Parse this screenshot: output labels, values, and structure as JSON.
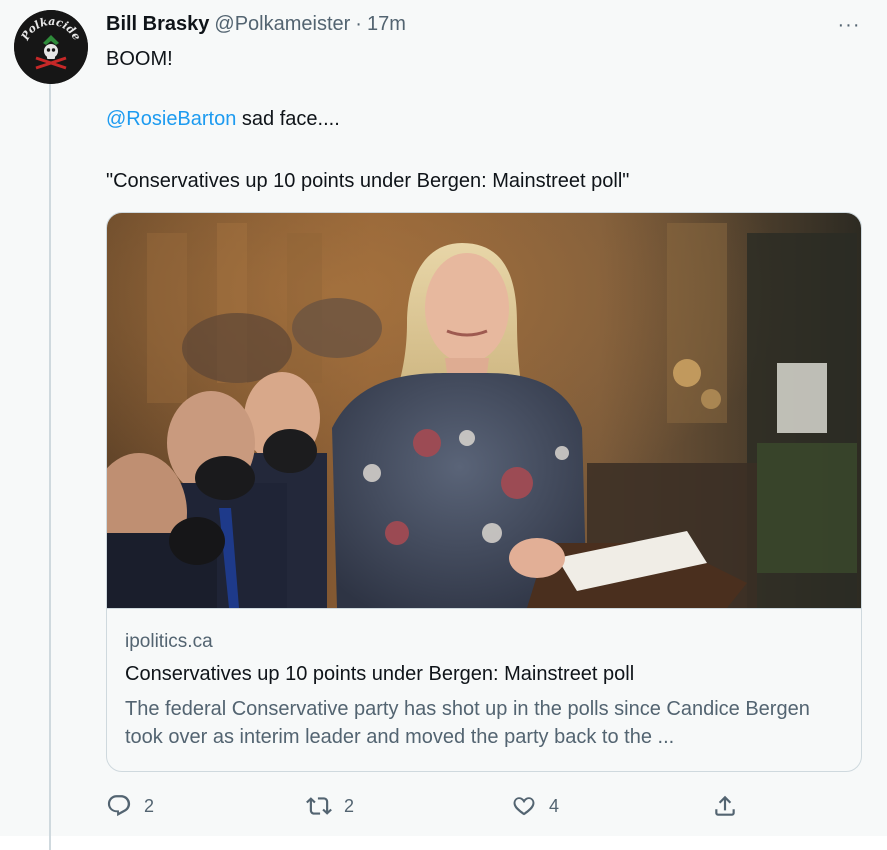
{
  "tweet": {
    "display_name": "Bill Brasky",
    "handle": "@Polkameister",
    "separator": "·",
    "time": "17m",
    "more_icon": "···",
    "line1": "BOOM!",
    "mention": "@RosieBarton",
    "line2_rest": " sad face....",
    "line3": "\"Conservatives up 10 points under Bergen: Mainstreet poll\"",
    "avatar_text": "Polkacide"
  },
  "card": {
    "domain": "ipolitics.ca",
    "title": "Conservatives up 10 points under Bergen: Mainstreet poll",
    "description": "The federal Conservative party has shot up in the polls since Candice Bergen took over as interim leader and moved the party back to the ..."
  },
  "actions": {
    "reply_count": "2",
    "retweet_count": "2",
    "like_count": "4"
  },
  "colors": {
    "accent": "#1d9bf0",
    "secondary_text": "#536471",
    "border": "#cfd9de"
  },
  "icons": [
    "avatar-logo",
    "more-icon",
    "reply-icon",
    "retweet-icon",
    "like-icon",
    "share-icon"
  ]
}
